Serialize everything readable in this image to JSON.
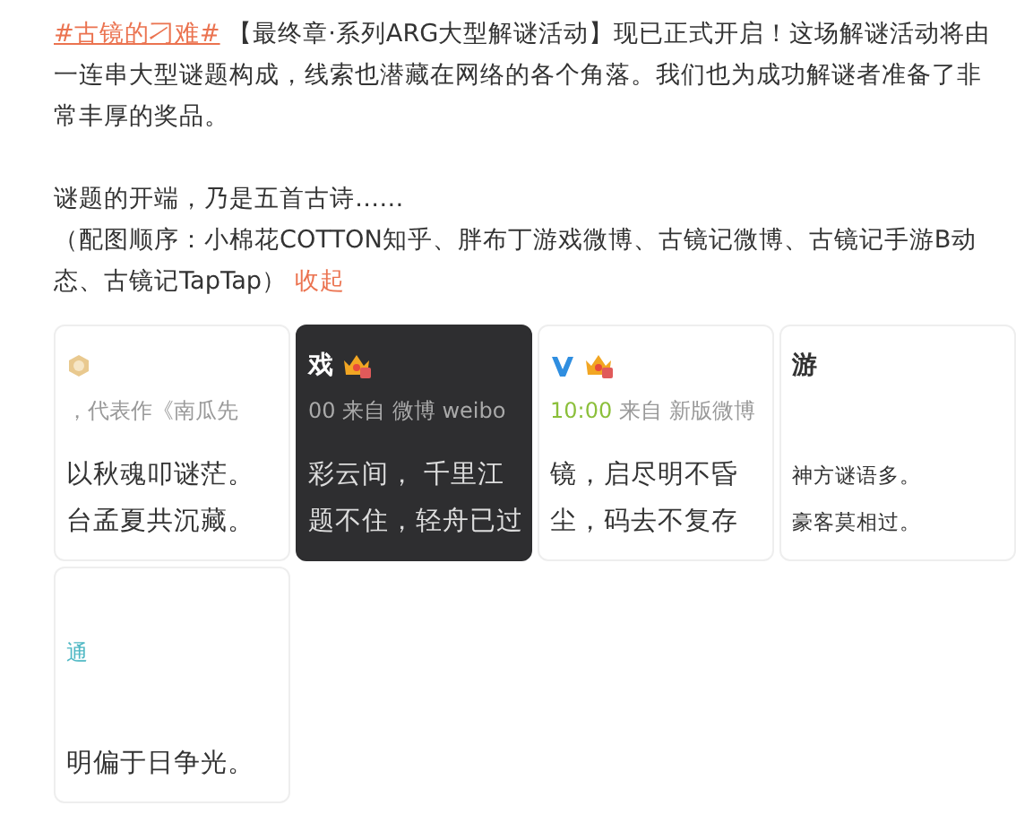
{
  "post": {
    "hashtag": "#古镜的刁难#",
    "text": "【最终章·系列ARG大型解谜活动】现已正式开启！这场解谜活动将由一连串大型谜题构成，线索也潜藏在网络的各个角落。我们也为成功解谜者准备了非常丰厚的奖品。",
    "intro": "谜题的开端，乃是五首古诗……",
    "caption": "（配图顺序：小棉花COTTON知乎、胖布丁游戏微博、古镜记微博、古镜记手游B动态、古镜记TapTap）",
    "collapse": "收起"
  },
  "images": [
    {
      "dark": false,
      "head": [
        {
          "kind": "medal"
        }
      ],
      "meta": {
        "source": "，代表作《南瓜先"
      },
      "lines": [
        {
          "kind": "body",
          "text": "以秋魂叩谜茫。"
        },
        {
          "kind": "body",
          "text": "台孟夏共沉藏。"
        }
      ]
    },
    {
      "dark": true,
      "head": [
        {
          "kind": "name",
          "text": "戏"
        },
        {
          "kind": "crown"
        }
      ],
      "meta": {
        "source": "00 来自 微博 weibo"
      },
      "lines": [
        {
          "kind": "body",
          "text": "彩云间， 千里江"
        },
        {
          "kind": "body",
          "text": "题不住，轻舟已过"
        }
      ]
    },
    {
      "dark": false,
      "head": [
        {
          "kind": "verified"
        },
        {
          "kind": "crown"
        }
      ],
      "meta": {
        "time": "10:00",
        "source": "来自 新版微博"
      },
      "lines": [
        {
          "kind": "body",
          "text": "镜，启尽明不昏"
        },
        {
          "kind": "body",
          "text": "尘，码去不复存"
        }
      ]
    },
    {
      "dark": false,
      "head": [
        {
          "kind": "name",
          "text": "游"
        }
      ],
      "lines": [
        {
          "kind": "note",
          "text": "神方谜语多。"
        },
        {
          "kind": "note",
          "text": "豪客莫相过。"
        }
      ]
    },
    {
      "dark": false,
      "meta": {
        "link": "通"
      },
      "lines": [
        {
          "kind": "body",
          "text": "明偏于日争光。"
        }
      ]
    }
  ]
}
